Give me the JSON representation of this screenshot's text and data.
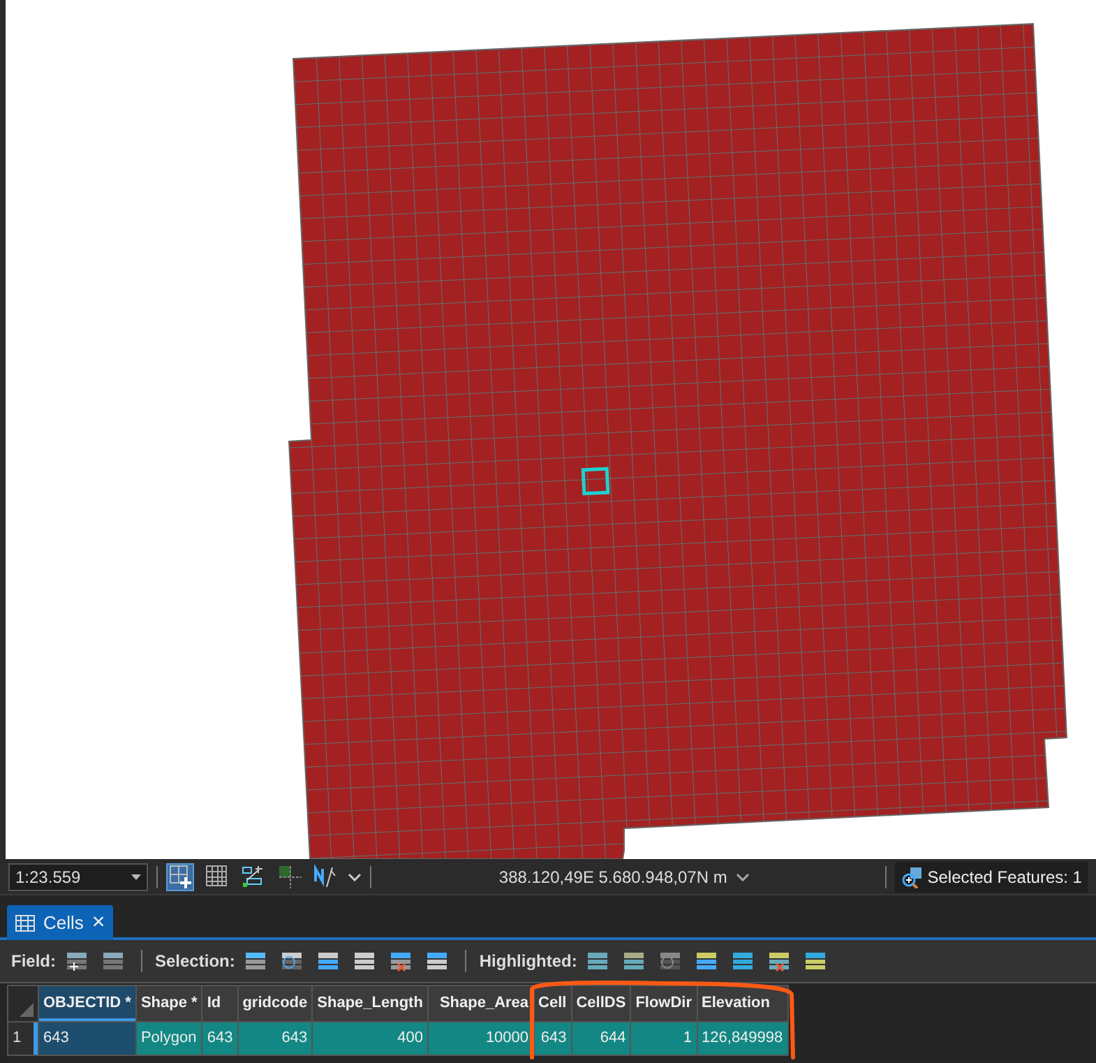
{
  "status_bar": {
    "scale": "1:23.559",
    "map_tools": [
      {
        "on": true
      },
      {
        "on": false
      },
      {
        "on": false
      },
      {
        "on": false
      },
      {
        "on": false
      }
    ],
    "coordinates": "388.120,49E 5.680.948,07N m",
    "selected_features": "Selected Features: 1"
  },
  "tabs": [
    {
      "label": "Cells",
      "selected": true,
      "close": "×"
    }
  ],
  "toolbar": {
    "groups": [
      {
        "label": "Field:"
      },
      {
        "label": "Selection:"
      },
      {
        "label": "Highlighted:"
      }
    ]
  },
  "table": {
    "columns": [
      {
        "label": "OBJECTID *",
        "kind": "text",
        "selected": true
      },
      {
        "label": "Shape *",
        "kind": "text",
        "selected": false
      },
      {
        "label": "Id",
        "kind": "text",
        "selected": false
      },
      {
        "label": "gridcode",
        "kind": "number",
        "selected": false
      },
      {
        "label": "Shape_Length",
        "kind": "number",
        "selected": false
      },
      {
        "label": "Shape_Area",
        "kind": "number",
        "selected": false
      },
      {
        "label": "Cell",
        "kind": "number",
        "selected": false
      },
      {
        "label": "CellDS",
        "kind": "number",
        "selected": false
      },
      {
        "label": "FlowDir",
        "kind": "number",
        "selected": false
      },
      {
        "label": "Elevation",
        "kind": "text",
        "selected": false
      }
    ],
    "rows": [
      {
        "number": "1",
        "selected": true,
        "cells": [
          "643",
          "Polygon",
          "643",
          "643",
          "400",
          "10000",
          "643",
          "644",
          "1",
          "126,849998"
        ]
      }
    ]
  }
}
